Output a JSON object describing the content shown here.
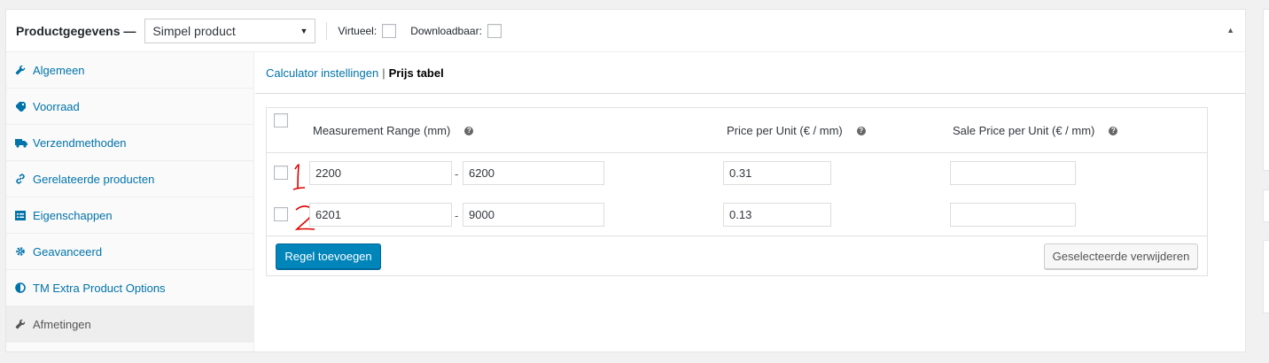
{
  "header": {
    "title": "Productgegevens —",
    "product_type": "Simpel product",
    "virtual_label": "Virtueel:",
    "downloadable_label": "Downloadbaar:"
  },
  "sidebar": {
    "items": [
      {
        "label": "Algemeen",
        "icon": "wrench-icon"
      },
      {
        "label": "Voorraad",
        "icon": "tag-icon"
      },
      {
        "label": "Verzendmethoden",
        "icon": "truck-icon"
      },
      {
        "label": "Gerelateerde producten",
        "icon": "link-icon"
      },
      {
        "label": "Eigenschappen",
        "icon": "list-icon"
      },
      {
        "label": "Geavanceerd",
        "icon": "gear-icon"
      },
      {
        "label": "TM Extra Product Options",
        "icon": "contrast-icon"
      },
      {
        "label": "Afmetingen",
        "icon": "wrench-icon",
        "active": true
      }
    ]
  },
  "subnav": {
    "calculator_settings": "Calculator instellingen",
    "separator": "|",
    "price_table": "Prijs tabel"
  },
  "table": {
    "headers": {
      "range": "Measurement Range (mm)",
      "price": "Price per Unit (€ / mm)",
      "sale_price": "Sale Price per Unit (€ / mm)"
    },
    "help_glyph": "?",
    "range_separator": "-",
    "rows": [
      {
        "from": "2200",
        "to": "6200",
        "price": "0.31",
        "sale_price": ""
      },
      {
        "from": "6201",
        "to": "9000",
        "price": "0.13",
        "sale_price": ""
      }
    ],
    "add_row_label": "Regel toevoegen",
    "delete_selected_label": "Geselecteerde verwijderen"
  },
  "colors": {
    "link": "#0073aa",
    "primary_button": "#0085ba",
    "annotation": "#e00000"
  }
}
